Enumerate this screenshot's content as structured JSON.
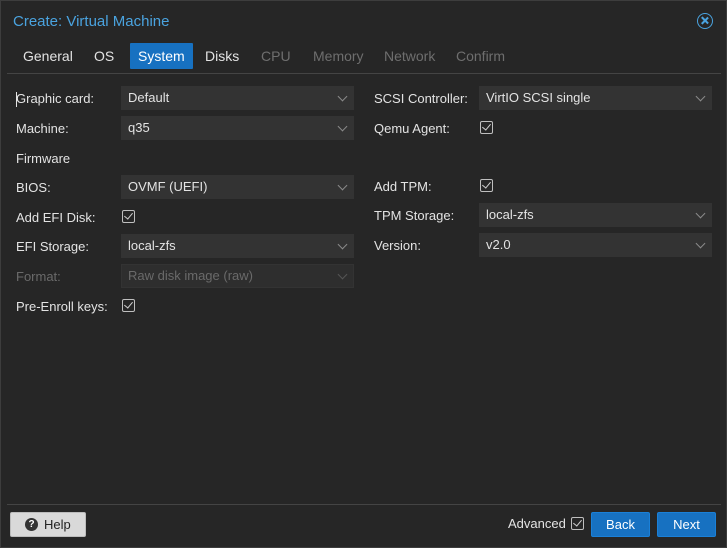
{
  "window": {
    "title": "Create: Virtual Machine"
  },
  "tabs": [
    {
      "label": "General",
      "state": "normal"
    },
    {
      "label": "OS",
      "state": "normal"
    },
    {
      "label": "System",
      "state": "active"
    },
    {
      "label": "Disks",
      "state": "normal"
    },
    {
      "label": "CPU",
      "state": "disabled"
    },
    {
      "label": "Memory",
      "state": "disabled"
    },
    {
      "label": "Network",
      "state": "disabled"
    },
    {
      "label": "Confirm",
      "state": "disabled"
    }
  ],
  "left": {
    "graphic_card": {
      "label": "Graphic card:",
      "value": "Default"
    },
    "machine": {
      "label": "Machine:",
      "value": "q35"
    },
    "firmware_heading": "Firmware",
    "bios": {
      "label": "BIOS:",
      "value": "OVMF (UEFI)"
    },
    "add_efi_disk": {
      "label": "Add EFI Disk:",
      "checked": true
    },
    "efi_storage": {
      "label": "EFI Storage:",
      "value": "local-zfs"
    },
    "format": {
      "label": "Format:",
      "value": "Raw disk image (raw)",
      "disabled": true
    },
    "pre_enroll": {
      "label": "Pre-Enroll keys:",
      "checked": true
    }
  },
  "right": {
    "scsi_controller": {
      "label": "SCSI Controller:",
      "value": "VirtIO SCSI single"
    },
    "qemu_agent": {
      "label": "Qemu Agent:",
      "checked": true
    },
    "add_tpm": {
      "label": "Add TPM:",
      "checked": true
    },
    "tpm_storage": {
      "label": "TPM Storage:",
      "value": "local-zfs"
    },
    "version": {
      "label": "Version:",
      "value": "v2.0"
    }
  },
  "footer": {
    "help_label": "Help",
    "advanced_label": "Advanced",
    "advanced_checked": true,
    "back_label": "Back",
    "next_label": "Next"
  },
  "colors": {
    "accent": "#1771c1",
    "title": "#4aa3df",
    "background": "#262626",
    "field": "#333333"
  },
  "icons": {
    "close": "close-circle-icon",
    "help": "question-circle-icon",
    "dropdown": "chevron-down-icon",
    "checkbox": "checkmark-icon"
  }
}
